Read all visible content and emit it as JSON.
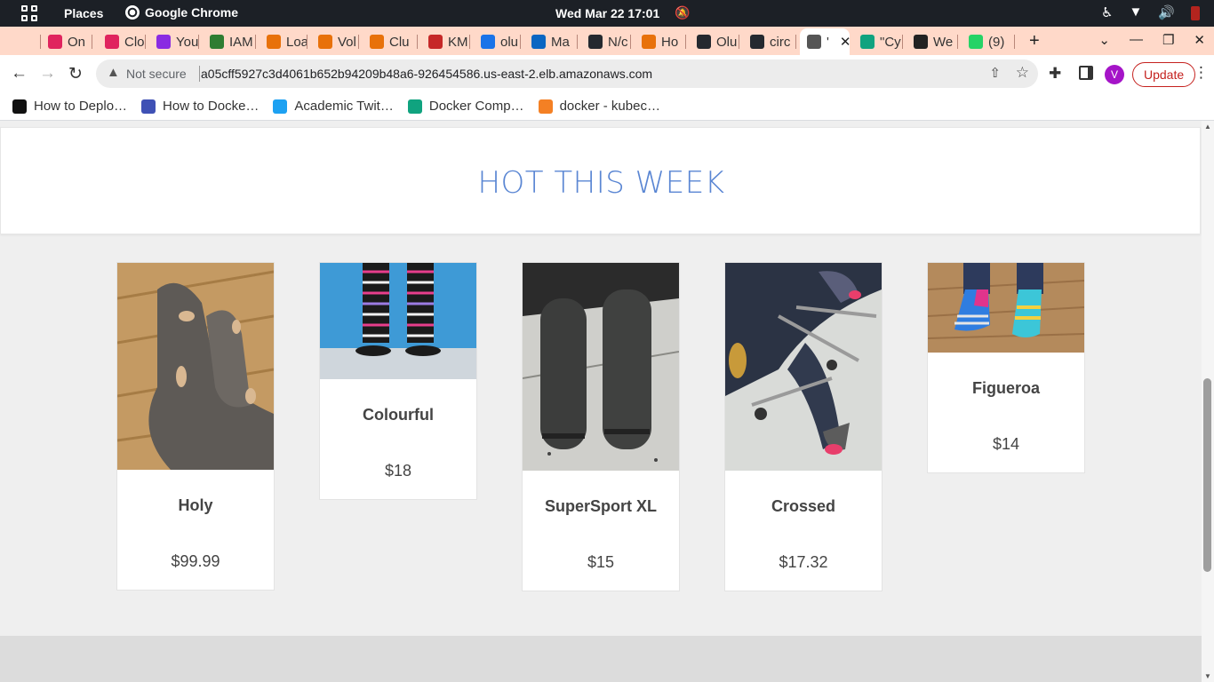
{
  "system_bar": {
    "places": "Places",
    "app_name": "Google Chrome",
    "clock": "Wed Mar 22  17:01"
  },
  "tabs": [
    {
      "label": "On",
      "color": "#e0245e"
    },
    {
      "label": "Clo",
      "color": "#e0245e"
    },
    {
      "label": "You",
      "color": "#8a2be2"
    },
    {
      "label": "IAM",
      "color": "#2e7d32"
    },
    {
      "label": "Loa",
      "color": "#e8710a"
    },
    {
      "label": "Vol",
      "color": "#e8710a"
    },
    {
      "label": "Clu",
      "color": "#e8710a"
    },
    {
      "label": "KM",
      "color": "#c62828"
    },
    {
      "label": "olu",
      "color": "#1a73e8"
    },
    {
      "label": "Ma",
      "color": "#0a66c2"
    },
    {
      "label": "N/c",
      "color": "#24292f"
    },
    {
      "label": "Ho",
      "color": "#e8710a"
    },
    {
      "label": "Olu",
      "color": "#24292f"
    },
    {
      "label": "circ",
      "color": "#24292f"
    },
    {
      "label": "'",
      "color": "#555555"
    },
    {
      "label": "\"Cy",
      "color": "#10a37f"
    },
    {
      "label": "We",
      "color": "#222222"
    },
    {
      "label": "(9)",
      "color": "#25d366"
    }
  ],
  "address_bar": {
    "security": "Not secure",
    "url": "a05cff5927c3d4061b652b94209b48a6-926454586.us-east-2.elb.amazonaws.com"
  },
  "profile_initial": "V",
  "update_label": "Update",
  "bookmarks": [
    {
      "label": "How to Deplo…",
      "color": "#111111"
    },
    {
      "label": "How to Docke…",
      "color": "#3f51b5"
    },
    {
      "label": "Academic Twit…",
      "color": "#1da1f2"
    },
    {
      "label": "Docker Comp…",
      "color": "#10a37f"
    },
    {
      "label": "docker - kubec…",
      "color": "#f48024"
    }
  ],
  "page": {
    "heading": "HOT THIS WEEK",
    "products": [
      {
        "name": "Holy",
        "price": "$99.99"
      },
      {
        "name": "Colourful",
        "price": "$18"
      },
      {
        "name": "SuperSport XL",
        "price": "$15"
      },
      {
        "name": "Crossed",
        "price": "$17.32"
      },
      {
        "name": "Figueroa",
        "price": "$14"
      }
    ]
  }
}
